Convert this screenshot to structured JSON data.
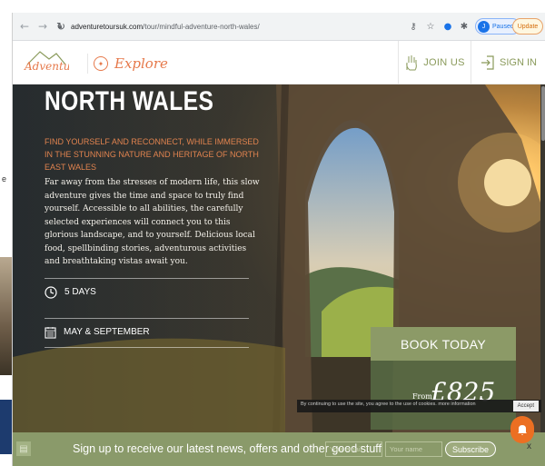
{
  "background_page": {
    "stray_letter": "e"
  },
  "browser": {
    "url_domain": "adventuretoursuk.com",
    "url_path": "/tour/mindful-adventure-north-wales/",
    "profile_label": "Paused",
    "update_label": "Update"
  },
  "site": {
    "logo_text": "Adventure",
    "explore_label": "Explore",
    "join_label": "JOIN US",
    "signin_label": "SIGN IN"
  },
  "hero": {
    "title": "NORTH WALES",
    "subtitle": "FIND YOURSELF AND RECONNECT, WHILE IMMERSED IN THE STUNNING NATURE AND HERITAGE OF NORTH EAST WALES",
    "body": "Far away from the stresses of modern life, this slow adventure gives the time and space to truly find yourself. Accessible to all abilities, the carefully selected experiences will connect you to this glorious landscape, and to yourself. Delicious local food, spellbinding stories, adventurous activities and breathtaking vistas await you.",
    "duration": "5 DAYS",
    "dates": "MAY & SEPTEMBER"
  },
  "booking": {
    "button_label": "BOOK TODAY",
    "from_label": "From",
    "price": "£825"
  },
  "cookie": {
    "text": "By continuing to use the site, you agree to the use of cookies. more information",
    "accept_label": "Accept"
  },
  "newsletter": {
    "text": "Sign up to receive our latest news, offers and other good stuff",
    "email_placeholder": "Your email",
    "name_placeholder": "Your name",
    "subscribe_label": "Subscribe",
    "close_label": "x"
  },
  "colors": {
    "accent": "#e6794b",
    "olive": "#8a9a6a",
    "chat": "#ec6f22"
  }
}
